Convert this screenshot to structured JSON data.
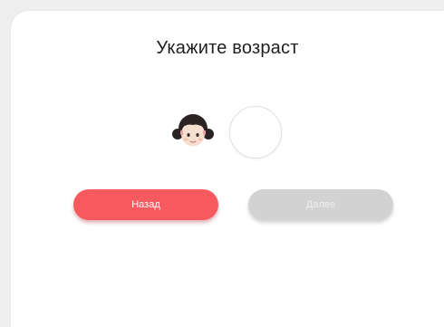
{
  "dialog": {
    "title": "Укажите возраст"
  },
  "avatar": {
    "icon": "girl-face-icon"
  },
  "age_input": {
    "value": ""
  },
  "buttons": {
    "back_label": "Назад",
    "next_label": "Далее",
    "back_color": "#f65a5f",
    "next_color": "#d2d2d2"
  }
}
